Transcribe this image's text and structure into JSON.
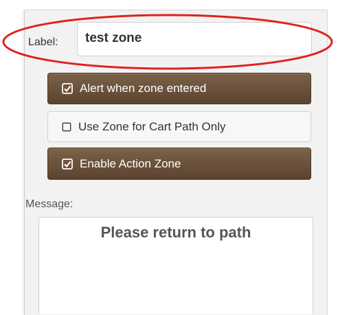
{
  "form": {
    "label_caption": "Label:",
    "label_value": "test zone",
    "message_caption": "Message:",
    "message_value": "Please return to path"
  },
  "toggles": [
    {
      "label": "Alert when zone entered",
      "checked": true
    },
    {
      "label": "Use Zone for Cart Path Only",
      "checked": false
    },
    {
      "label": "Enable Action Zone",
      "checked": true
    }
  ],
  "colors": {
    "active_button": "#6b5138",
    "highlight_ellipse": "#e0211d"
  },
  "icons": {
    "checked": "check-square-icon",
    "unchecked": "empty-square-icon"
  }
}
